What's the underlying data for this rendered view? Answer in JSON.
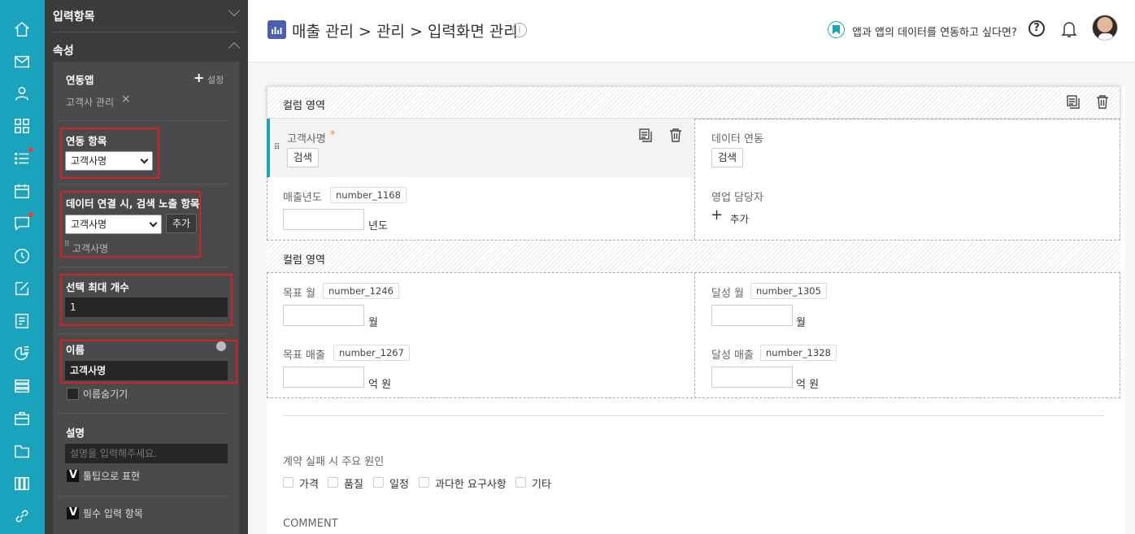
{
  "panel": {
    "section1": "입력항목",
    "section2": "속성",
    "linked_app_label": "연동앱",
    "settings_label": "설정",
    "linked_app_value": "고객사 관리",
    "link_field_label": "연동 항목",
    "link_field_value": "고객사명",
    "search_field_label": "데이터 연결 시, 검색 노출 항목",
    "search_field_value": "고객사명",
    "add_label": "추가",
    "search_item": "고객사명",
    "max_label": "선택 최대 개수",
    "max_value": "1",
    "name_label": "이름",
    "name_value": "고객사명",
    "hide_name_label": "이름숨기기",
    "desc_label": "설명",
    "desc_placeholder": "설명을 입력해주세요.",
    "tooltip_label": "툴팁으로 표현",
    "required_label": "필수 입력 항목"
  },
  "header": {
    "title": "매출 관리 > 관리 > 입력화면 관리",
    "promo": "앱과 앱의 데이터를 연동하고 싶다면?"
  },
  "form": {
    "sec1_title": "컬럼 영역",
    "sec2_title": "컬럼 영역",
    "customer_label": "고객사명",
    "required_mark": "*",
    "search_btn": "검색",
    "data_link_label": "데이터 연동",
    "search_btn2": "검색",
    "year_label": "매출년도",
    "year_tag": "number_1168",
    "year_unit": "년도",
    "sales_rep_label": "영업 담당자",
    "add_label": "추가",
    "target_month_label": "목표 월",
    "target_month_tag": "number_1246",
    "month_unit": "월",
    "achieved_month_label": "달성 월",
    "achieved_month_tag": "number_1305",
    "month_unit2": "월",
    "target_sales_label": "목표 매출",
    "target_sales_tag": "number_1267",
    "money_unit": "억 원",
    "achieved_sales_label": "달성 매출",
    "achieved_sales_tag": "number_1328",
    "money_unit2": "억 원",
    "fail_reason_label": "계약 실패 시 주요 원인",
    "options": [
      "가격",
      "품질",
      "일정",
      "과다한 요구사항",
      "기타"
    ],
    "comment_label": "COMMENT"
  },
  "colors": {
    "rail": "#1aa3bd",
    "accent": "#1aa3bd",
    "panel": "#3c3c3c",
    "highlight_border": "#d92020",
    "brand_icon": "#4a5fb0"
  }
}
